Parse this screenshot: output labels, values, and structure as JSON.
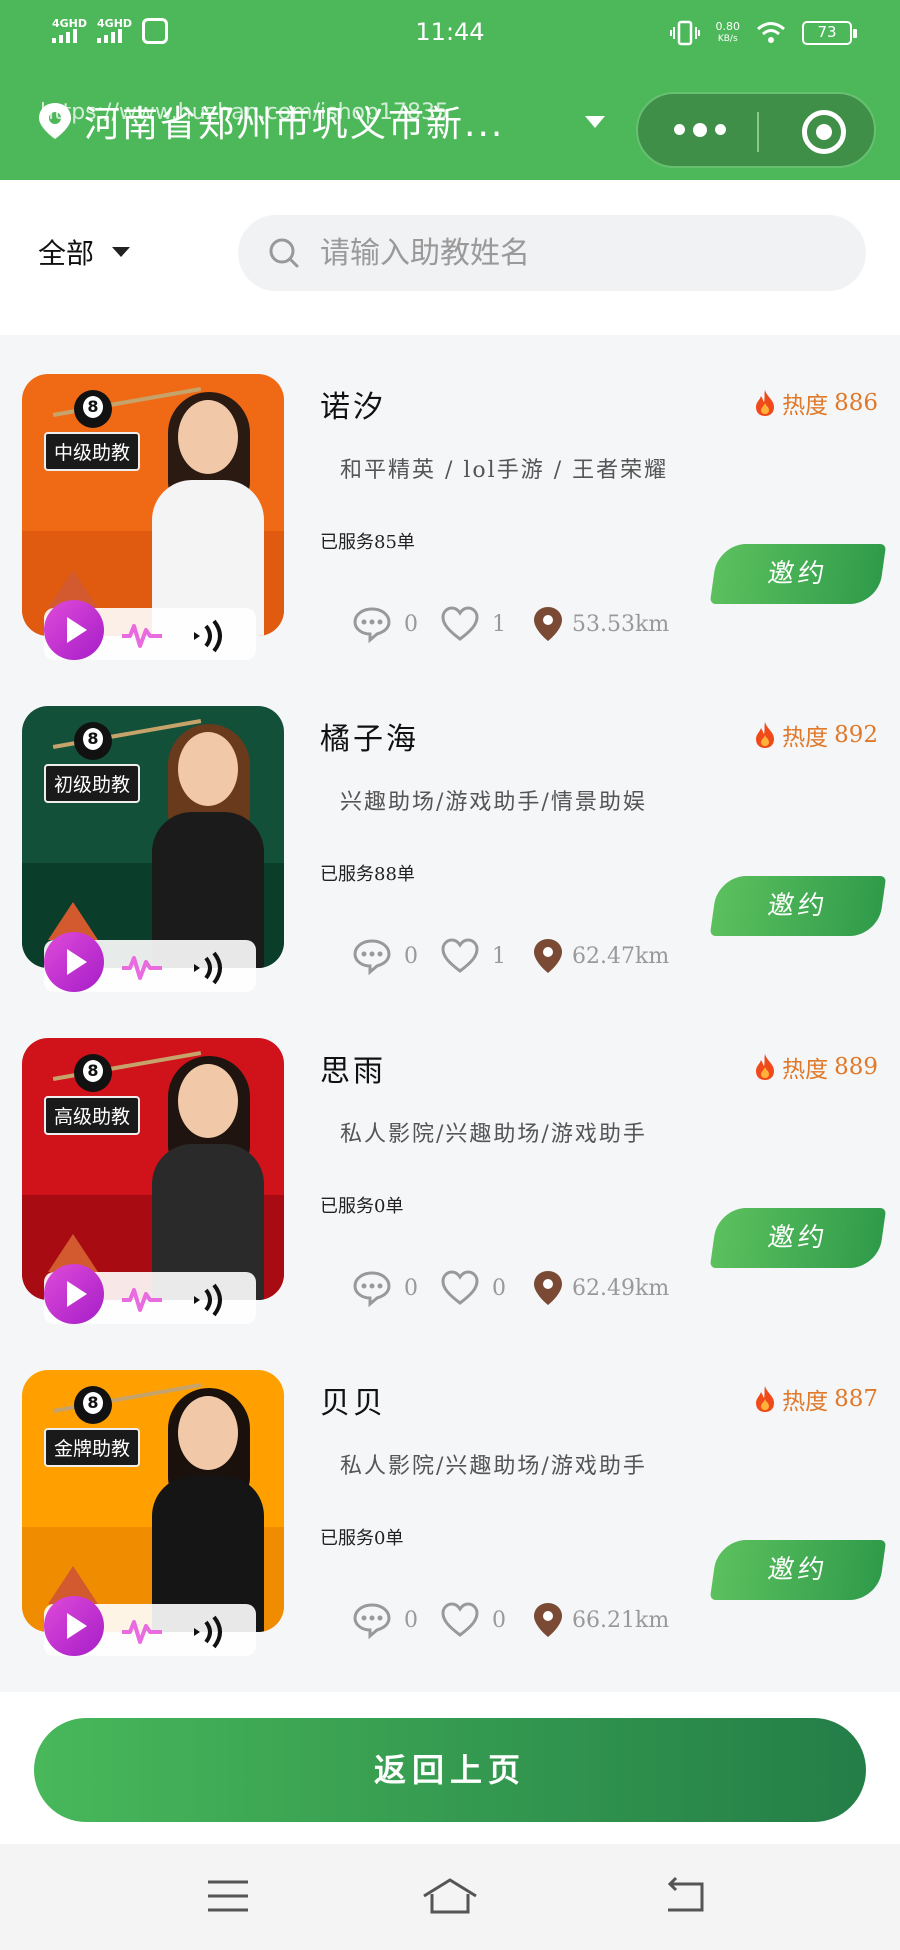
{
  "status_bar": {
    "network_1": "4GHD",
    "network_2": "4GHD",
    "time": "11:44",
    "speed_value": "0.80",
    "speed_unit": "KB/s",
    "battery": "73"
  },
  "header": {
    "location": "河南省郑州市巩义市新...",
    "watermark": "https://www.huzhan.com/ishop17835"
  },
  "filter": {
    "category": "全部",
    "search_placeholder": "请输入助教姓名"
  },
  "assistants": [
    {
      "name": "诺汐",
      "heat_label": "热度",
      "heat": "886",
      "tags": "和平精英 / lol手游 / 王者荣耀",
      "served": "已服务85单",
      "comments": "0",
      "likes": "1",
      "distance": "53.53km",
      "level": "中级助教",
      "invite": "邀约",
      "poster_color": "#f06a16",
      "band_color": "#e05a10",
      "hair_color": "#2b1a12",
      "body_color": "#f4f4f4"
    },
    {
      "name": "橘子海",
      "heat_label": "热度",
      "heat": "892",
      "tags": "兴趣助场/游戏助手/情景助娱",
      "served": "已服务88单",
      "comments": "0",
      "likes": "1",
      "distance": "62.47km",
      "level": "初级助教",
      "invite": "邀约",
      "poster_color": "#12503a",
      "band_color": "#0b3d2b",
      "hair_color": "#6a3a1c",
      "body_color": "#1b1b1b"
    },
    {
      "name": "思雨",
      "heat_label": "热度",
      "heat": "889",
      "tags": "私人影院/兴趣助场/游戏助手",
      "served": "已服务0单",
      "comments": "0",
      "likes": "0",
      "distance": "62.49km",
      "level": "高级助教",
      "invite": "邀约",
      "poster_color": "#d0121a",
      "band_color": "#a80c12",
      "hair_color": "#1f140f",
      "body_color": "#2a2a2a"
    },
    {
      "name": "贝贝",
      "heat_label": "热度",
      "heat": "887",
      "tags": "私人影院/兴趣助场/游戏助手",
      "served": "已服务0单",
      "comments": "0",
      "likes": "0",
      "distance": "66.21km",
      "level": "金牌助教",
      "invite": "邀约",
      "poster_color": "#ffa000",
      "band_color": "#f08c00",
      "hair_color": "#1a110c",
      "body_color": "#151515"
    }
  ],
  "bottom": {
    "back_label": "返回上页"
  },
  "colors": {
    "brand_green": "#4db85a",
    "heat_orange": "#e0792a",
    "play_purple": "#c02fd0"
  }
}
